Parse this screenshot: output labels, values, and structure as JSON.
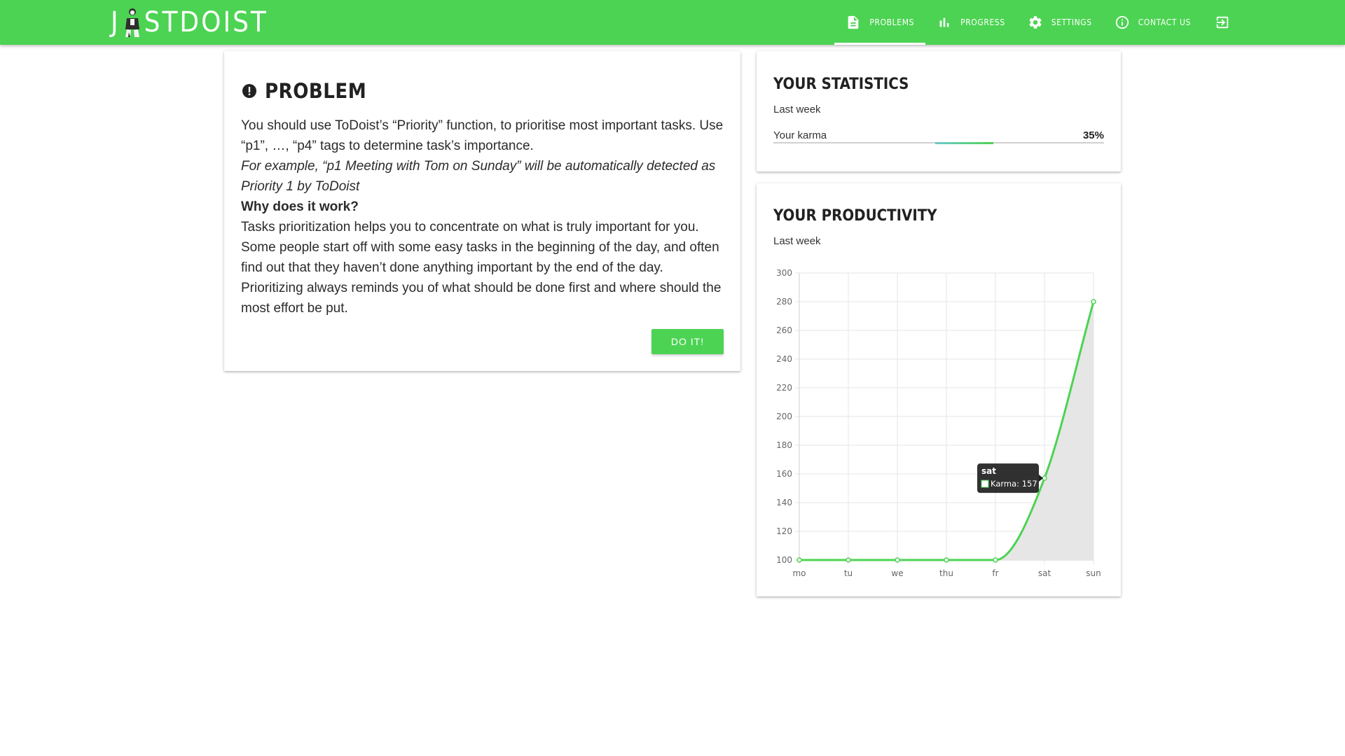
{
  "header": {
    "logo_text_before": "J",
    "logo_text_after": "STDOIST",
    "nav": [
      {
        "label": "PROBLEMS",
        "icon": "document-icon",
        "active": true
      },
      {
        "label": "PROGRESS",
        "icon": "bar-chart-icon",
        "active": false
      },
      {
        "label": "SETTINGS",
        "icon": "gear-icon",
        "active": false
      },
      {
        "label": "CONTACT US",
        "icon": "info-icon",
        "active": false
      }
    ],
    "exit_icon": "exit-icon",
    "colors": {
      "bar": "#4cd353",
      "text": "#ffffff"
    }
  },
  "problem": {
    "title": "PROBLEM",
    "paragraph1": "You should use ToDoist’s “Priority” function, to prioritise most important tasks. Use “p1”, …, “p4” tags to determine task’s importance.",
    "example": "For example, “p1 Meeting with Tom on Sunday” will be automatically detected as Priority 1 by ToDoist",
    "why_heading": "Why does it work?",
    "paragraph2": "Tasks prioritization helps you to concentrate on what is truly important for you. Some people start off with some easy tasks in the beginning of the day, and often find out that they haven’t done anything important by the end of the day. Prioritizing always reminds you of what should be done first and where should the most effort be put.",
    "button_label": "DO IT!"
  },
  "statistics": {
    "title": "YOUR STATISTICS",
    "period": "Last week",
    "karma_label": "Your karma",
    "karma_value": "35%",
    "karma_fraction": 0.35
  },
  "productivity": {
    "title": "YOUR PRODUCTIVITY",
    "period": "Last week"
  },
  "chart_data": {
    "type": "area",
    "categories": [
      "mo",
      "tu",
      "we",
      "thu",
      "fr",
      "sat",
      "sun"
    ],
    "series": [
      {
        "values": [
          100,
          100,
          100,
          100,
          100,
          157,
          280
        ],
        "color": "#4cd353",
        "fill": "#e3e3e3"
      }
    ],
    "ylim": [
      100,
      300
    ],
    "yticks": [
      100,
      120,
      140,
      160,
      180,
      200,
      220,
      240,
      260,
      280,
      300
    ],
    "grid": true,
    "tooltip": {
      "title": "sat",
      "label": "Karma: 157"
    }
  }
}
